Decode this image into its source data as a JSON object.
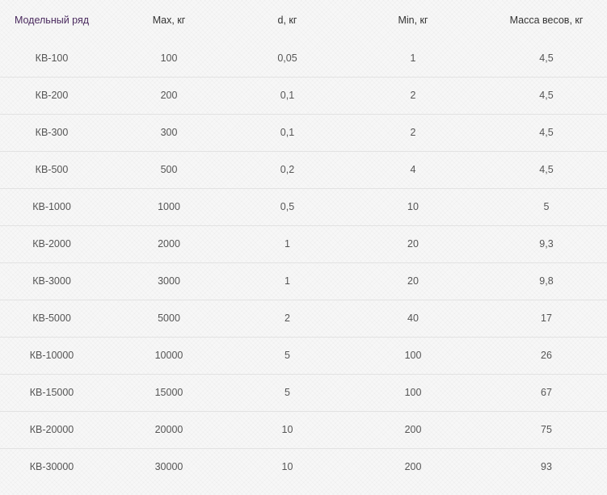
{
  "table": {
    "headers": [
      "Модельный ряд",
      "Max, кг",
      "d, кг",
      "Min, кг",
      "Масса весов, кг"
    ],
    "rows": [
      [
        "КВ-100",
        "100",
        "0,05",
        "1",
        "4,5"
      ],
      [
        "КВ-200",
        "200",
        "0,1",
        "2",
        "4,5"
      ],
      [
        "КВ-300",
        "300",
        "0,1",
        "2",
        "4,5"
      ],
      [
        "КВ-500",
        "500",
        "0,2",
        "4",
        "4,5"
      ],
      [
        "КВ-1000",
        "1000",
        "0,5",
        "10",
        "5"
      ],
      [
        "КВ-2000",
        "2000",
        "1",
        "20",
        "9,3"
      ],
      [
        "КВ-3000",
        "3000",
        "1",
        "20",
        "9,8"
      ],
      [
        "КВ-5000",
        "5000",
        "2",
        "40",
        "17"
      ],
      [
        "КВ-10000",
        "10000",
        "5",
        "100",
        "26"
      ],
      [
        "КВ-15000",
        "15000",
        "5",
        "100",
        "67"
      ],
      [
        "КВ-20000",
        "20000",
        "10",
        "200",
        "75"
      ],
      [
        "КВ-30000",
        "30000",
        "10",
        "200",
        "93"
      ]
    ]
  },
  "colors": {
    "header_first": "#4a2a5e",
    "header_text": "#333333",
    "cell_text": "#555555",
    "divider": "#e2e2e2",
    "background": "#f7f7f7"
  }
}
